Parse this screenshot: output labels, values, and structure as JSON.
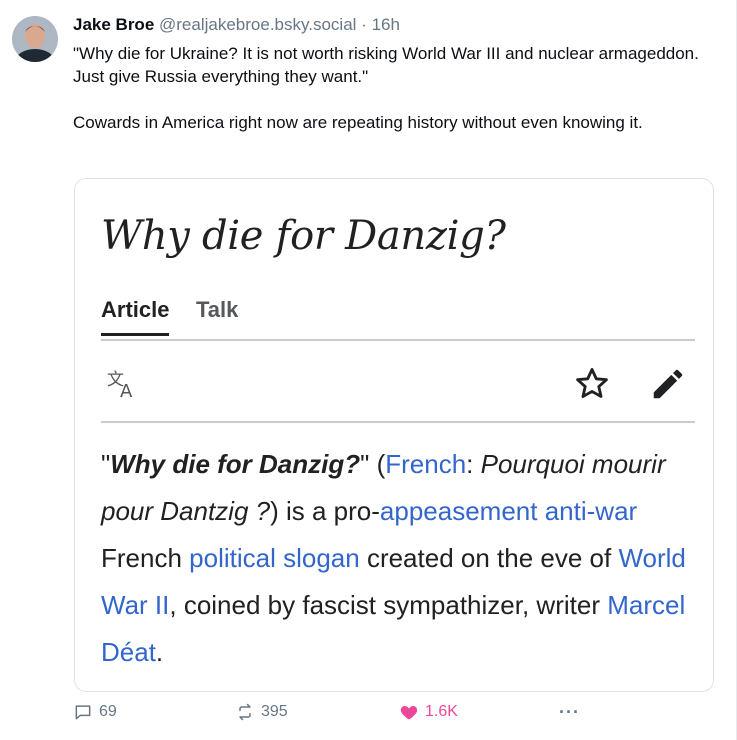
{
  "post": {
    "author_name": "Jake Broe",
    "handle": "@realjakebroe.bsky.social",
    "separator": "·",
    "time": "16h",
    "text_p1": "\"Why die for Ukraine?  It is not worth risking World War III and nuclear armageddon.  Just give Russia everything they want.\"",
    "text_p2": "Cowards in America right now are repeating history without even knowing it."
  },
  "embed": {
    "title": "Why die for Danzig?",
    "tabs": [
      {
        "label": "Article"
      },
      {
        "label": "Talk"
      }
    ],
    "icons": [
      "translate-icon",
      "star-icon",
      "edit-pencil-icon"
    ],
    "body": {
      "q_open": "\"",
      "bold_title": "Why die for Danzig?",
      "q_close": "\" (",
      "link_french": "French",
      "colon": ": ",
      "french_phrase": "Pourquoi mourir pour Dantzig ?",
      "after_phrase": ") is a pro-",
      "link_appeasement": "appeasement",
      "space1": " ",
      "link_antiwar": "anti-war",
      "mid1": " French ",
      "link_slogan": "political slogan",
      "mid2": " created on the eve of ",
      "link_ww2": "World War II",
      "mid3": ", coined by fascist sympathizer, writer ",
      "link_deat": "Marcel Déat",
      "end": "."
    }
  },
  "actions": {
    "replies": "69",
    "reposts": "395",
    "likes": "1.6K",
    "more_label": "···"
  },
  "colors": {
    "link": "#3366cc",
    "like": "#ec4899",
    "muted": "#687684"
  }
}
